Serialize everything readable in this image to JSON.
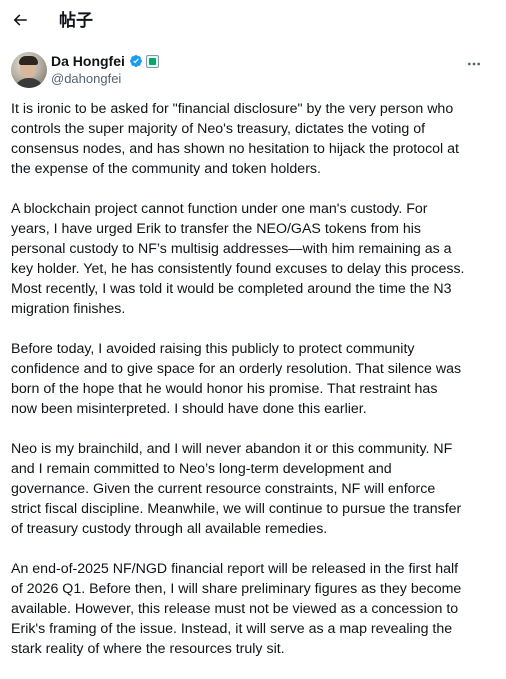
{
  "header": {
    "title": "帖子"
  },
  "author": {
    "name": "Da Hongfei",
    "handle": "@dahongfei"
  },
  "post": {
    "paragraphs": [
      "It is ironic to be asked for \"financial disclosure\" by the very person who\ncontrols the super majority of Neo's treasury, dictates the voting of\nconsensus nodes, and has shown no hesitation to hijack the protocol at\nthe expense of the community and token holders.",
      "A blockchain project cannot function under one man's custody. For\nyears, I have urged Erik to transfer the NEO/GAS tokens from his\npersonal custody to NF’s multisig addresses—with him remaining as a\nkey holder. Yet, he has consistently found excuses to delay this process.\nMost recently, I was told it would be completed around the time the N3\nmigration finishes.",
      "Before today, I avoided raising this publicly to protect community\nconfidence and to give space for an orderly resolution. That silence was\nborn of the hope that he would honor his promise. That restraint has\nnow been misinterpreted. I should have done this earlier.",
      "Neo is my brainchild, and I will never abandon it or this community. NF\nand I remain committed to Neo’s long-term development and\ngovernance. Given the current resource constraints, NF will enforce\nstrict fiscal discipline. Meanwhile, we will continue to pursue the transfer\nof treasury custody through all available remedies.",
      "An end-of-2025 NF/NGD financial report will be released in the first half\nof 2026 Q1. Before then, I will share preliminary figures as they become\navailable. However, this release must not be viewed as a concession to\nErik's framing of the issue. Instead, it will serve as a map revealing the\nstark reality of where the resources truly sit."
    ]
  },
  "icons": {
    "back": "arrow-left-icon",
    "verified": "verified-badge-icon",
    "affiliate": "affiliate-badge-icon",
    "more": "more-horizontal-icon"
  },
  "colors": {
    "text": "#0f1419",
    "secondary": "#536471",
    "verified": "#1d9bf0"
  }
}
